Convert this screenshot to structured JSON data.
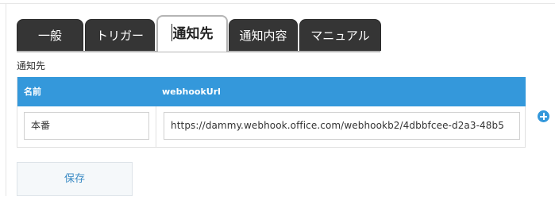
{
  "tabs": [
    {
      "label": "一般"
    },
    {
      "label": "トリガー"
    },
    {
      "label": "通知先"
    },
    {
      "label": "通知内容"
    },
    {
      "label": "マニュアル"
    }
  ],
  "active_tab": "通知先",
  "section": {
    "title": "通知先"
  },
  "table": {
    "headers": {
      "name": "名前",
      "url": "webhookUrl"
    },
    "rows": [
      {
        "name": "本番",
        "url": "https://dammy.webhook.office.com/webhookb2/4dbbfcee-d2a3-48b5"
      }
    ]
  },
  "buttons": {
    "save_label": "保存",
    "add_icon": "plus-circle-icon"
  },
  "colors": {
    "accent": "#3498db",
    "tab_dark": "#353535"
  }
}
